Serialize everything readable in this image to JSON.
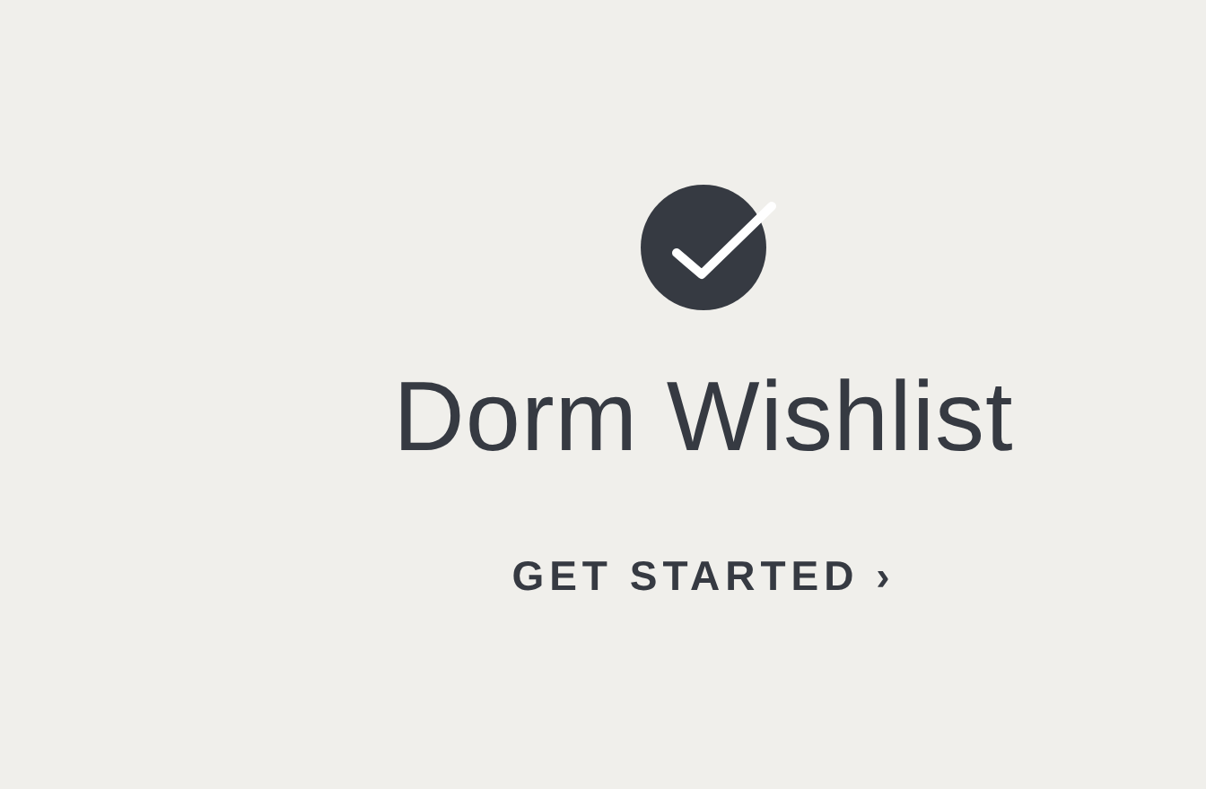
{
  "slide": {
    "title": "Dorm Wishlist",
    "link": "GET STARTED ›"
  }
}
